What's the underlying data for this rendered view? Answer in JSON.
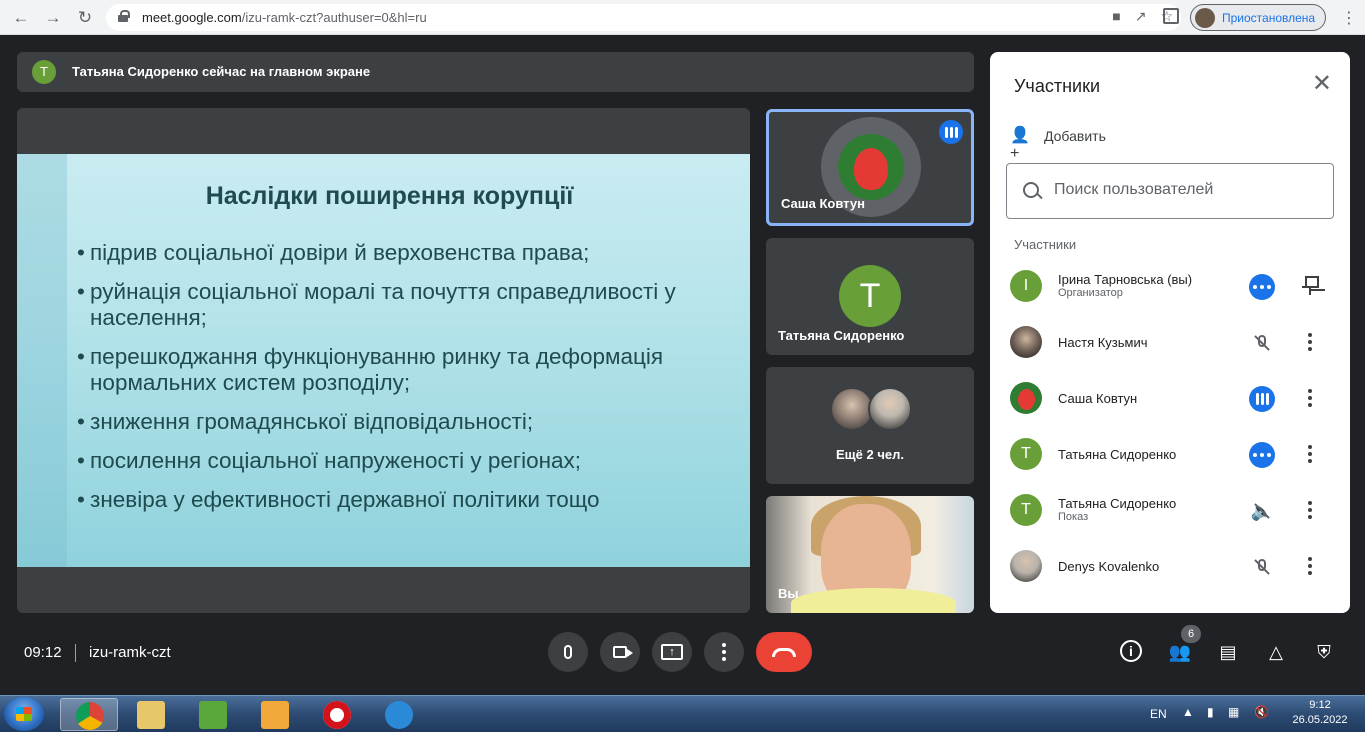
{
  "browser": {
    "url_host": "meet.google.com",
    "url_path": "/izu-ramk-czt?authuser=0&hl=ru",
    "profile_label": "Приостановлена"
  },
  "banner": {
    "avatar_letter": "T",
    "text": "Татьяна Сидоренко сейчас на главном экране"
  },
  "slide": {
    "title": "Наслідки поширення корупції",
    "bullets": [
      "підрив соціальної довіри й верховенства права;",
      "руйнація соціальної моралі та почуття  справедливості у населення;",
      "перешкоджання функціонуванню ринку та  деформація нормальних систем розподілу;",
      "зниження громадянської відповідальності;",
      "посилення соціальної напруженості у регіонах;",
      "зневіра у ефективності державної політики тощо"
    ]
  },
  "tiles": {
    "t1_name": "Саша Ковтун",
    "t2_name": "Татьяна Сидоренко",
    "t2_letter": "T",
    "t3_label": "Ещё 2 чел.",
    "t4_name": "Вы"
  },
  "panel": {
    "title": "Участники",
    "add_label": "Добавить",
    "search_placeholder": "Поиск пользователей",
    "section_label": "Участники",
    "participants": [
      {
        "letter": "I",
        "name": "Ірина Тарновська (вы)",
        "sub": "Организатор",
        "status": "dots",
        "action": "pin"
      },
      {
        "letter": "",
        "name": "Настя Кузьмич",
        "sub": "",
        "status": "muted",
        "action": "more"
      },
      {
        "letter": "",
        "name": "Саша Ковтун",
        "sub": "",
        "status": "speaking",
        "action": "more"
      },
      {
        "letter": "T",
        "name": "Татьяна Сидоренко",
        "sub": "",
        "status": "dots",
        "action": "more"
      },
      {
        "letter": "T",
        "name": "Татьяна Сидоренко",
        "sub": "Показ",
        "status": "muted-audio",
        "action": "more"
      },
      {
        "letter": "",
        "name": "Denys Kovalenko",
        "sub": "",
        "status": "muted",
        "action": "more"
      }
    ]
  },
  "bottom": {
    "time": "09:12",
    "meeting_code": "izu-ramk-czt",
    "participant_count": "6"
  },
  "taskbar": {
    "lang": "EN",
    "clock_time": "9:12",
    "clock_date": "26.05.2022"
  },
  "colors": {
    "meet_bg": "#202124",
    "tile_bg": "#3c4043",
    "accent_blue": "#1a73e8",
    "avatar_green": "#689f38",
    "hangup_red": "#ea4335"
  }
}
